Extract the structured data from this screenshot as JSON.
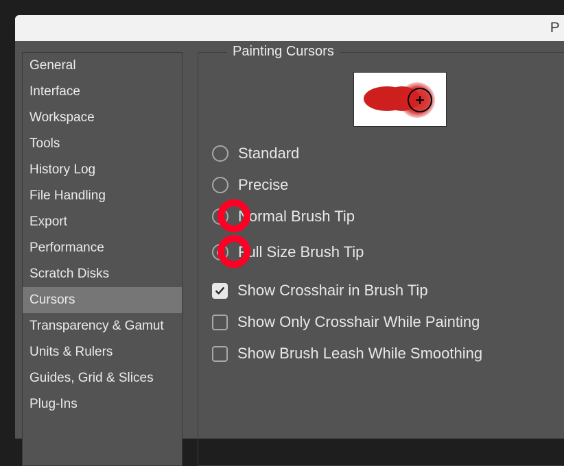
{
  "titlebar": {
    "truncated_title": "P"
  },
  "sidebar": {
    "items": [
      {
        "label": "General",
        "selected": false
      },
      {
        "label": "Interface",
        "selected": false
      },
      {
        "label": "Workspace",
        "selected": false
      },
      {
        "label": "Tools",
        "selected": false
      },
      {
        "label": "History Log",
        "selected": false
      },
      {
        "label": "File Handling",
        "selected": false
      },
      {
        "label": "Export",
        "selected": false
      },
      {
        "label": "Performance",
        "selected": false
      },
      {
        "label": "Scratch Disks",
        "selected": false
      },
      {
        "label": "Cursors",
        "selected": true
      },
      {
        "label": "Transparency & Gamut",
        "selected": false
      },
      {
        "label": "Units & Rulers",
        "selected": false
      },
      {
        "label": "Guides, Grid & Slices",
        "selected": false
      },
      {
        "label": "Plug-Ins",
        "selected": false
      }
    ]
  },
  "painting_cursors": {
    "group_title": "Painting Cursors",
    "radios": [
      {
        "label": "Standard",
        "selected": false,
        "highlight": false
      },
      {
        "label": "Precise",
        "selected": false,
        "highlight": false
      },
      {
        "label": "Normal Brush Tip",
        "selected": false,
        "highlight": true
      },
      {
        "label": "Full Size Brush Tip",
        "selected": true,
        "highlight": true
      }
    ],
    "checkboxes": [
      {
        "label": "Show Crosshair in Brush Tip",
        "checked": true
      },
      {
        "label": "Show Only Crosshair While Painting",
        "checked": false
      },
      {
        "label": "Show Brush Leash While Smoothing",
        "checked": false
      }
    ]
  },
  "annotation": {
    "highlight_color": "#ff0024"
  }
}
